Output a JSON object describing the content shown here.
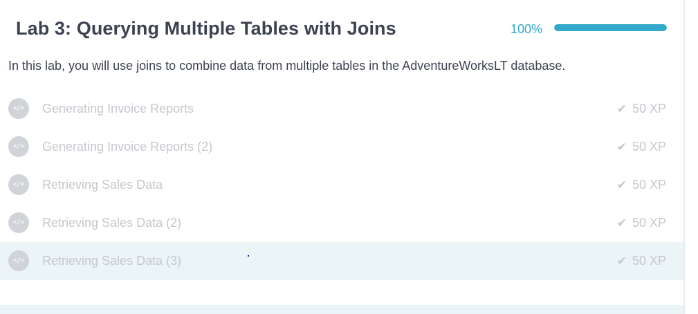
{
  "header": {
    "title": "Lab 3: Querying Multiple Tables with Joins",
    "progress_label": "100%",
    "progress_fraction": 1.0
  },
  "description": "In this lab, you will use joins to combine data from multiple tables in the AdventureWorksLT database.",
  "exercises": [
    {
      "icon": "code-icon",
      "icon_text": "</>",
      "title": "Generating Invoice Reports",
      "xp": "50 XP",
      "completed": true
    },
    {
      "icon": "code-icon",
      "icon_text": "</>",
      "title": "Generating Invoice Reports (2)",
      "xp": "50 XP",
      "completed": true
    },
    {
      "icon": "code-icon",
      "icon_text": "</>",
      "title": "Retrieving Sales Data",
      "xp": "50 XP",
      "completed": true
    },
    {
      "icon": "code-icon",
      "icon_text": "</>",
      "title": "Retrieving Sales Data (2)",
      "xp": "50 XP",
      "completed": true
    },
    {
      "icon": "code-icon",
      "icon_text": "</>",
      "title": "Retrieving Sales Data (3)",
      "xp": "50 XP",
      "completed": true
    }
  ],
  "colors": {
    "accent": "#33aacc",
    "title_text": "#3d4251",
    "muted_text": "#c5c8cd",
    "highlight_row": "#ebf4f7"
  }
}
